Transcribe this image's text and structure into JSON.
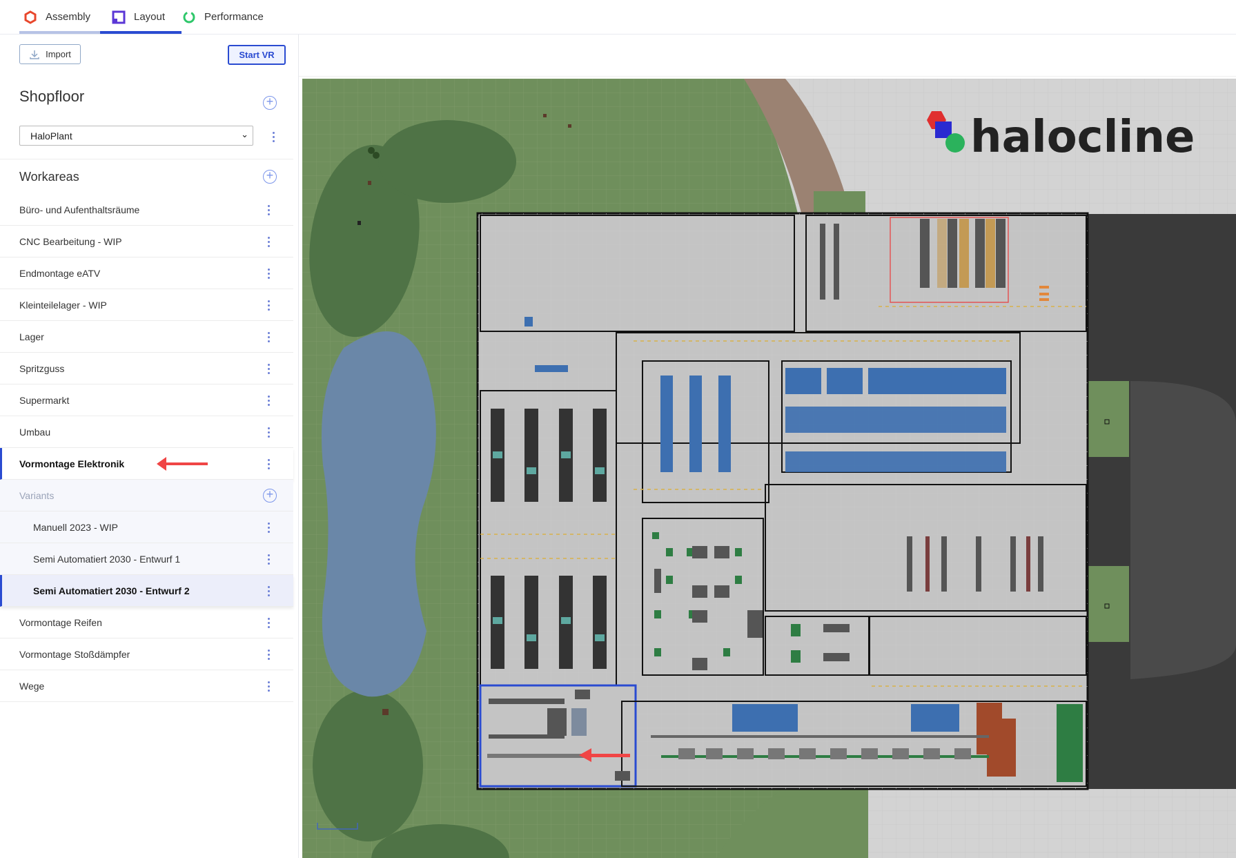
{
  "tabs": [
    {
      "label": "Assembly",
      "color": "#e8472c",
      "active": false
    },
    {
      "label": "Layout",
      "color": "#5b37d6",
      "active": true
    },
    {
      "label": "Performance",
      "color": "#2ec76a",
      "active": false
    }
  ],
  "toolbar": {
    "import_label": "Import",
    "start_vr_label": "Start VR"
  },
  "shopfloor": {
    "title": "Shopfloor",
    "selected": "HaloPlant"
  },
  "workareas": {
    "title": "Workareas",
    "items": [
      {
        "label": "Büro- und Aufenthaltsräume"
      },
      {
        "label": "CNC Bearbeitung - WIP"
      },
      {
        "label": "Endmontage eATV"
      },
      {
        "label": "Kleinteilelager - WIP"
      },
      {
        "label": "Lager"
      },
      {
        "label": "Spritzguss"
      },
      {
        "label": "Supermarkt"
      },
      {
        "label": "Umbau"
      },
      {
        "label": "Vormontage Elektronik"
      },
      {
        "label": "Variants"
      },
      {
        "label": "Manuell 2023 - WIP"
      },
      {
        "label": "Semi Automatiert 2030 - Entwurf 1"
      },
      {
        "label": "Semi Automatiert 2030 - Entwurf 2"
      },
      {
        "label": "Vormontage Reifen"
      },
      {
        "label": "Vormontage Stoßdämpfer"
      },
      {
        "label": "Wege"
      }
    ]
  },
  "map": {
    "logo_text": "halocline"
  },
  "colors": {
    "accent": "#2a4bd1",
    "arrow": "#f04545",
    "grass": "#6f8f5c",
    "water": "#6a87a8"
  }
}
